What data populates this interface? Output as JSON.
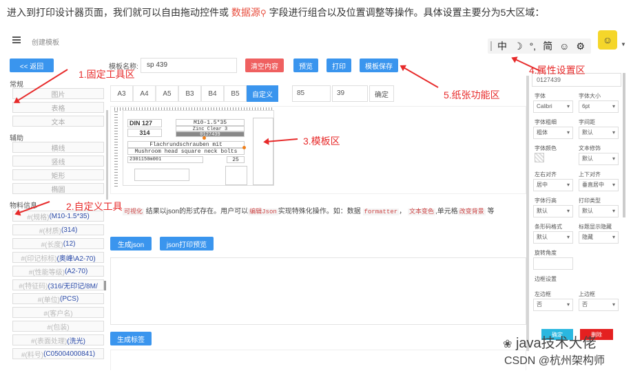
{
  "intro": {
    "before": "进入到打印设计器页面，我们就可以自由拖动控件或 ",
    "link": "数据源",
    "after": " 字段进行组合以及位置调整等操作。具体设置主要分为5大区域："
  },
  "topbar": {
    "breadcrumb": "创建模板",
    "ime": [
      "中",
      "☽",
      "°,",
      "简",
      "☺",
      "⚙"
    ]
  },
  "left": {
    "back": "<< 返回",
    "section_common": "常规",
    "common_items": [
      "图片",
      "表格",
      "文本"
    ],
    "section_aux": "辅助",
    "aux_items": [
      "横线",
      "竖线",
      "矩形",
      "椭圆"
    ],
    "section_fields": "物料信息",
    "field_items": [
      {
        "p": "#(规格)",
        "v": "(M10-1.5*35)"
      },
      {
        "p": "#(材质)",
        "v": "(314)"
      },
      {
        "p": "#(长度)",
        "v": "(12)"
      },
      {
        "p": "#(印记标标)",
        "v": "(奥峰\\A2-70)"
      },
      {
        "p": "#(性能等级)",
        "v": "(A2-70)"
      },
      {
        "p": "#(特征码)",
        "v": "(316/无印记/8M/"
      },
      {
        "p": "#(单位)",
        "v": "(PCS)"
      },
      {
        "p": "#(客户名)",
        "v": ""
      },
      {
        "p": "#(包装)",
        "v": ""
      },
      {
        "p": "#(表面处理)",
        "v": "(洗光)"
      },
      {
        "p": "#(料号)",
        "v": "(C05004000841)"
      }
    ]
  },
  "center": {
    "name_label": "模板名称:",
    "name_value": "sp 439",
    "buttons": {
      "clear": "清空内容",
      "preview": "预览",
      "print": "打印",
      "save": "模板保存"
    },
    "sizes": [
      "A3",
      "A4",
      "A5",
      "B3",
      "B4",
      "B5",
      "自定义"
    ],
    "width": "85",
    "height": "39",
    "confirm": "确定",
    "label": {
      "din": "DIN 127",
      "code": "314",
      "spec": "M10-1.5*35",
      "line2": "Zinc Clear 3",
      "barcode": "0127439",
      "de": "Flachrundschrauben mit",
      "en": "Mushroom head square neck bolts",
      "lot": "2301150m001",
      "qty": "25"
    },
    "hint_before": "结果以json的形式存在。用户可以",
    "hint_c1": "可视化",
    "hint_c2": "编辑Json",
    "hint_mid": "实现特殊化操作。如：数据",
    "hint_c3": "formatter",
    "hint_sep": "，",
    "hint_c4": "文本变色",
    "hint_mid2": ",单元格",
    "hint_c5": "改变背景",
    "hint_end": "等",
    "gen_json": "生成json",
    "json_preview": "json打印预览",
    "gen_label": "生成标签"
  },
  "right": {
    "value": "0127439",
    "rows": [
      {
        "l1": "字体",
        "v1": "Calibri",
        "l2": "字体大小",
        "v2": "6pt"
      },
      {
        "l1": "字体粗细",
        "v1": "粗体",
        "l2": "字间距",
        "v2": "默认"
      },
      {
        "l1": "字体颜色",
        "v1": "",
        "l2": "文本修饰",
        "v2": "默认"
      },
      {
        "l1": "左右对齐",
        "v1": "居中",
        "l2": "上下对齐",
        "v2": "垂直居中"
      },
      {
        "l1": "字体行高",
        "v1": "默认",
        "l2": "打印类型",
        "v2": "默认"
      },
      {
        "l1": "条形码格式",
        "v1": "默认",
        "l2": "标题显示隐藏",
        "v2": "隐藏"
      }
    ],
    "rotate_label": "旋转角度",
    "border_label": "边框设置",
    "left_border": "左边框",
    "left_border_v": "否",
    "top_border": "上边框",
    "top_border_v": "否",
    "ok": "确定",
    "delete": "删除"
  },
  "annotations": {
    "a1": "1.固定工具区",
    "a2": "2.自定义工具",
    "a3": "3.模板区",
    "a4": "4.属性设置区",
    "a5": "5.纸张功能区"
  },
  "watermark": {
    "line1": "java技术大佬",
    "line2": "CSDN @杭州架构师"
  },
  "colors": {
    "accent": "#3a95ee",
    "annotation": "#e72a2a",
    "danger": "#ef6060"
  }
}
